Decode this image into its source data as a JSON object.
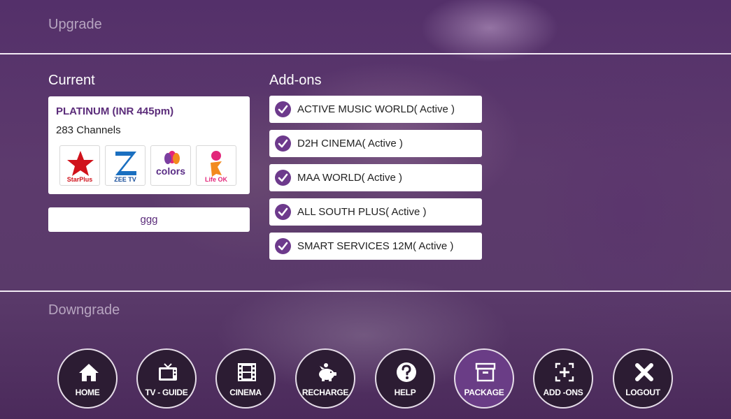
{
  "upgrade_label": "Upgrade",
  "downgrade_label": "Downgrade",
  "current": {
    "title": "Current",
    "plan_name": "PLATINUM (INR 445pm)",
    "channels": "283 Channels",
    "logos": [
      {
        "name": "StarPlus",
        "caption": "StarPlus"
      },
      {
        "name": "ZEE TV",
        "caption": "ZEE TV"
      },
      {
        "name": "colors",
        "caption": "colors"
      },
      {
        "name": "Life OK",
        "caption": "Life OK"
      }
    ],
    "button_label": "ggg"
  },
  "addons": {
    "title": "Add-ons",
    "items": [
      {
        "label": "ACTIVE MUSIC WORLD( Active )"
      },
      {
        "label": "D2H CINEMA( Active )"
      },
      {
        "label": "MAA WORLD( Active )"
      },
      {
        "label": "ALL SOUTH PLUS( Active )"
      },
      {
        "label": "SMART SERVICES 12M( Active )"
      }
    ]
  },
  "nav": [
    {
      "label": "HOME",
      "icon": "home-icon"
    },
    {
      "label": "TV - GUIDE",
      "icon": "tv-icon"
    },
    {
      "label": "CINEMA",
      "icon": "film-icon"
    },
    {
      "label": "RECHARGE",
      "icon": "piggy-bank-icon"
    },
    {
      "label": "HELP",
      "icon": "question-icon"
    },
    {
      "label": "PACKAGE",
      "icon": "package-icon",
      "active": true
    },
    {
      "label": "ADD -ONS",
      "icon": "add-ons-icon"
    },
    {
      "label": "LOGOUT",
      "icon": "close-icon"
    }
  ],
  "colors": {
    "accent": "#5b2c7a",
    "check": "#6d3a8c",
    "active_nav": "#6a3d86"
  }
}
